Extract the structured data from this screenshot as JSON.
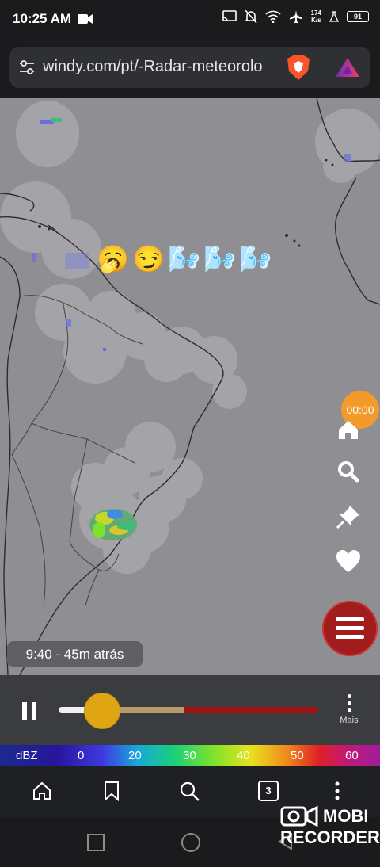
{
  "status_bar": {
    "time": "10:25 AM",
    "network_speed_value": "174",
    "network_speed_unit": "K/s",
    "battery": "91",
    "icons": [
      "video-record-icon",
      "cast-icon",
      "notifications-off-icon",
      "wifi-icon",
      "airplane-icon",
      "lab-icon",
      "battery-icon"
    ]
  },
  "url_bar": {
    "url": "windy.com/pt/-Radar-meteorolo",
    "icons": [
      "tune-icon",
      "brave-shield-icon",
      "brave-rewards-icon"
    ]
  },
  "map": {
    "emoji_overlay": "🥱😏🌬️🌬️🌬️",
    "timestamp_label": "9:40 - 45m atrás",
    "timer_label": "00:00",
    "side_icons": [
      "home-icon",
      "search-icon",
      "pin-icon",
      "heart-icon"
    ]
  },
  "player": {
    "more_label": "Mais",
    "progress": 0.14
  },
  "color_scale": {
    "unit": "dBZ",
    "ticks": [
      "0",
      "20",
      "30",
      "40",
      "50",
      "60"
    ]
  },
  "browser_bar": {
    "tabs_count": "3",
    "icons": [
      "home-icon",
      "bookmark-icon",
      "search-icon",
      "tabs-icon",
      "more-icon"
    ]
  },
  "watermark": {
    "line1": "MOBI",
    "line2": "RECORDER"
  }
}
